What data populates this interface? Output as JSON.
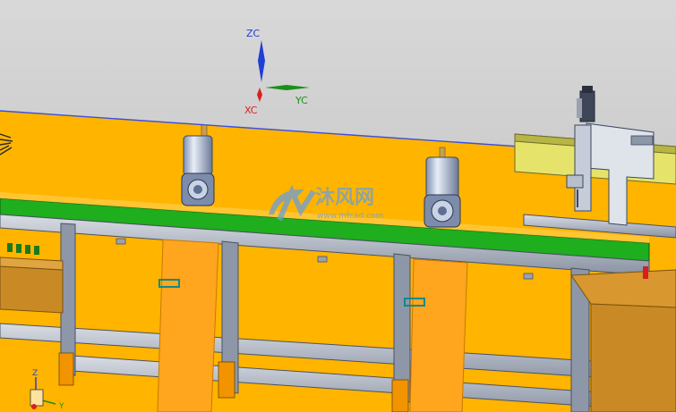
{
  "viewport": {
    "background_top": "#d6d6d6",
    "background_bottom": "#bdbdbd",
    "plane_color": "#ffb400"
  },
  "wcs_triad": {
    "z_label": "ZC",
    "y_label": "YC",
    "x_label": "XC",
    "z_color": "#1f3fd6",
    "y_color": "#1a8f1a",
    "x_color": "#d91f1f"
  },
  "mini_triad": {
    "z_label": "Z",
    "y_label": "Y"
  },
  "watermark": {
    "title": "沐风网",
    "url": "www.mfcad.com",
    "color": "#6a9fd8"
  },
  "model_parts": {
    "conveyor_belt": "green-belt",
    "motors": [
      "servo-motor-left",
      "servo-motor-right"
    ],
    "gantry": "pick-and-place-gantry"
  }
}
